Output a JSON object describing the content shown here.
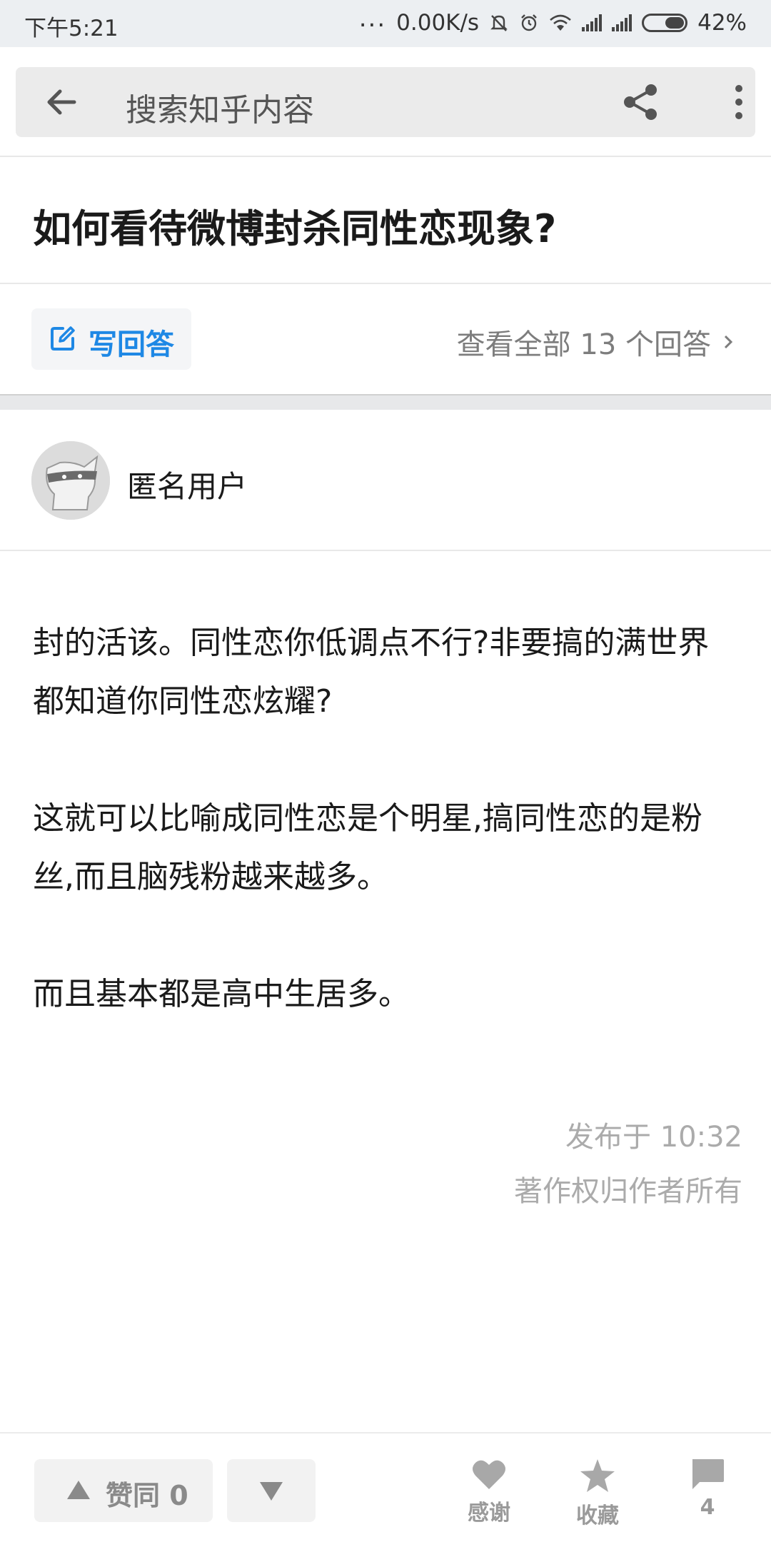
{
  "status_bar": {
    "time": "下午5:21",
    "dots": "...",
    "network_speed": "0.00K/s",
    "battery": "42%",
    "icons": [
      "mute-icon",
      "alarm-icon",
      "wifi-icon",
      "signal-icon",
      "signal-icon",
      "battery-icon"
    ]
  },
  "search_bar": {
    "placeholder": "搜索知乎内容",
    "icons": [
      "back-arrow-icon",
      "share-icon",
      "more-vertical-icon"
    ]
  },
  "question": {
    "title": "如何看待微博封杀同性恋现象?"
  },
  "actions": {
    "write_answer": "写回答",
    "view_all": "查看全部 13 个回答"
  },
  "answer": {
    "author": "匿名用户",
    "paragraphs": [
      "封的活该。同性恋你低调点不行?非要搞的满世界都知道你同性恋炫耀?",
      "这就可以比喻成同性恋是个明星,搞同性恋的是粉丝,而且脑残粉越来越多。",
      "而且基本都是高中生居多。"
    ],
    "published": "发布于 10:32",
    "copyright": "著作权归作者所有"
  },
  "bottom_bar": {
    "upvote": "赞同 0",
    "thanks": "感谢",
    "collect": "收藏",
    "comments": "4"
  },
  "colors": {
    "accent": "#1e88e5",
    "status_bar_bg": "#eceff2",
    "muted_text": "#ababab"
  }
}
